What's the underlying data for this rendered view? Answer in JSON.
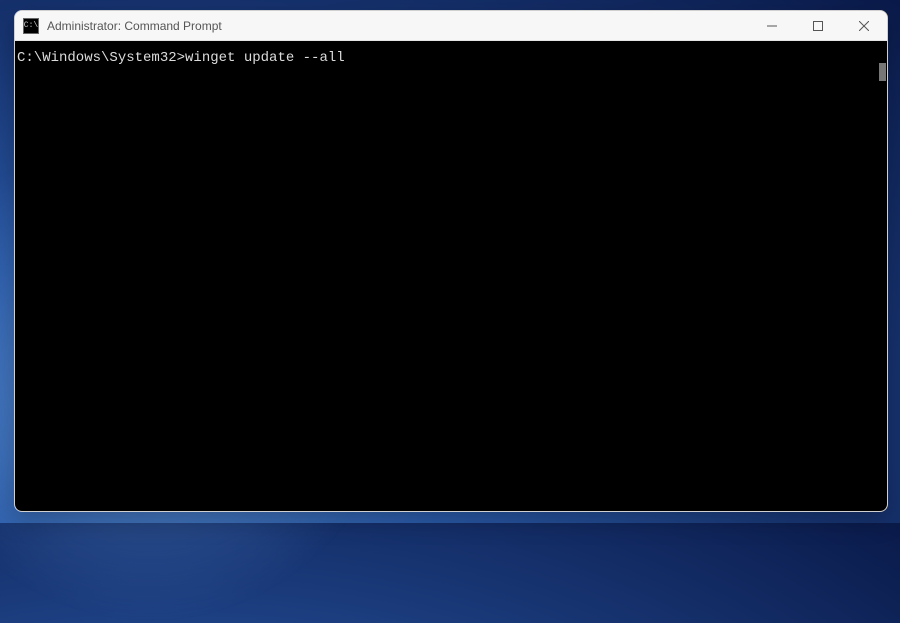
{
  "window": {
    "title": "Administrator: Command Prompt",
    "app_icon_text": "C:\\"
  },
  "terminal": {
    "prompt": "C:\\Windows\\System32>",
    "command": "winget update --all"
  }
}
